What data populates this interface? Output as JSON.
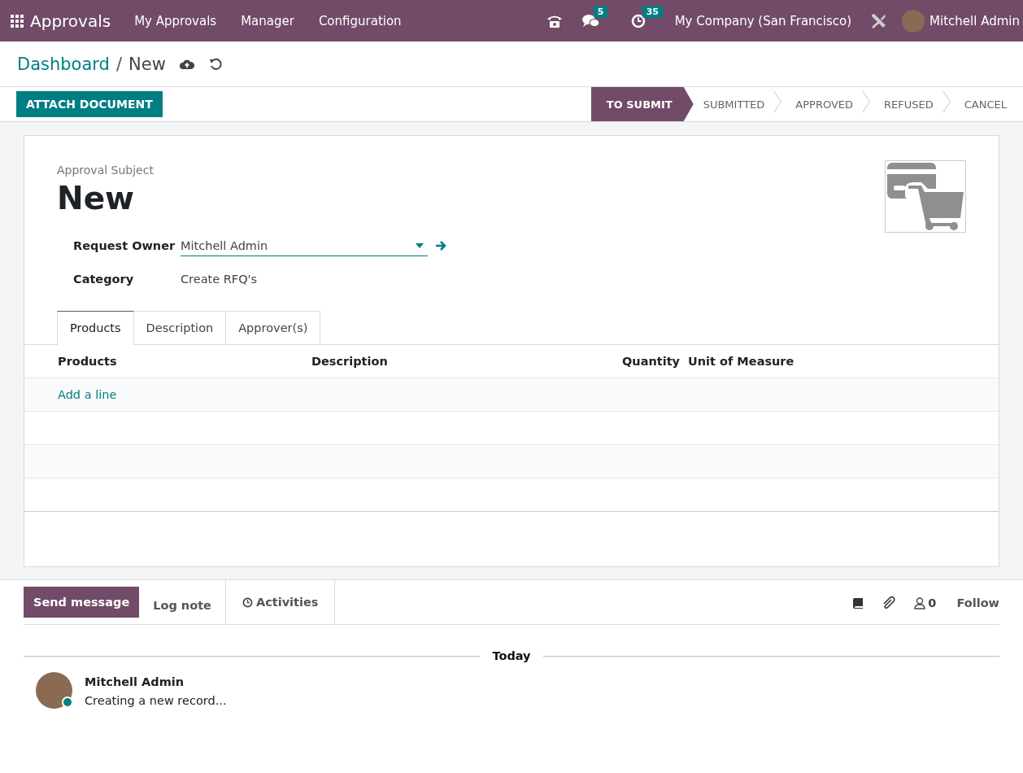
{
  "navbar": {
    "app_name": "Approvals",
    "menus": [
      "My Approvals",
      "Manager",
      "Configuration"
    ],
    "messages_count": "5",
    "activities_count": "35",
    "company": "My Company (San Francisco)",
    "user": "Mitchell Admin"
  },
  "breadcrumb": {
    "parent": "Dashboard",
    "separator": "/",
    "current": "New"
  },
  "action_button": "ATTACH DOCUMENT",
  "statusbar": [
    {
      "label": "TO SUBMIT",
      "selected": true
    },
    {
      "label": "SUBMITTED",
      "selected": false
    },
    {
      "label": "APPROVED",
      "selected": false
    },
    {
      "label": "REFUSED",
      "selected": false
    },
    {
      "label": "CANCEL",
      "selected": false
    }
  ],
  "form": {
    "subject_label": "Approval Subject",
    "title": "New",
    "fields": [
      {
        "label": "Request Owner",
        "value": "Mitchell Admin",
        "kind": "many2one"
      },
      {
        "label": "Category",
        "value": "Create RFQ's",
        "kind": "readonly"
      }
    ],
    "tabs": [
      {
        "label": "Products",
        "selected": true
      },
      {
        "label": "Description",
        "selected": false
      },
      {
        "label": "Approver(s)",
        "selected": false
      }
    ],
    "columns": [
      "Products",
      "Description",
      "Quantity",
      "Unit of Measure"
    ],
    "add_line": "Add a line"
  },
  "chatter": {
    "buttons": [
      {
        "label": "Send message",
        "kind": "primary",
        "selected": true
      },
      {
        "label": "Log note",
        "kind": "plain",
        "selected": false
      },
      {
        "label": "Activities",
        "kind": "activity",
        "selected": false
      }
    ],
    "followers": "0",
    "follow": "Follow",
    "date_separator": "Today",
    "messages": [
      {
        "author": "Mitchell Admin",
        "body": "Creating a new record...",
        "online": true
      }
    ]
  }
}
